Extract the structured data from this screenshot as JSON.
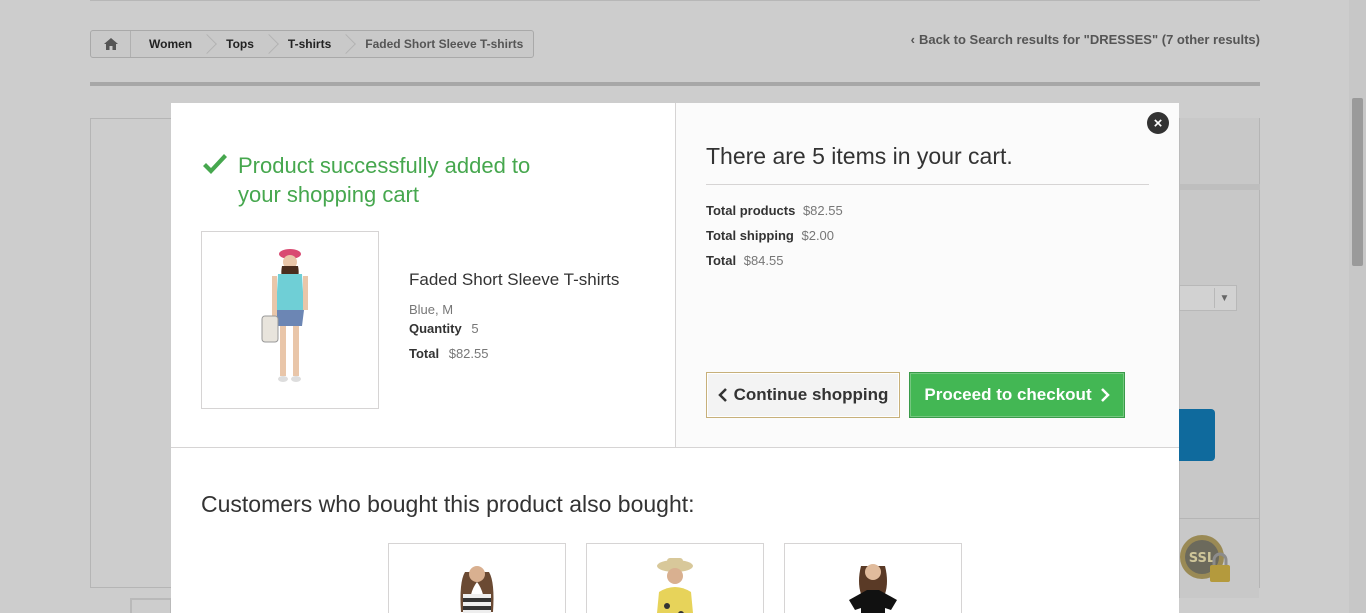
{
  "breadcrumb": {
    "home_icon": "home-icon",
    "items": [
      "Women",
      "Tops",
      "T-shirts"
    ],
    "current": "Faded Short Sleeve T-shirts"
  },
  "back_link": "Back to Search results for \"DRESSES\" (7 other results)",
  "modal": {
    "success_message": "Product successfully added to your shopping cart",
    "product": {
      "name": "Faded Short Sleeve T-shirts",
      "attributes": "Blue, M",
      "quantity_label": "Quantity",
      "quantity": "5",
      "total_label": "Total",
      "total": "$82.55"
    },
    "cart": {
      "title": "There are 5 items in your cart.",
      "total_products_label": "Total products",
      "total_products": "$82.55",
      "total_shipping_label": "Total shipping",
      "total_shipping": "$2.00",
      "total_label": "Total",
      "total": "$84.55"
    },
    "continue_label": "Continue shopping",
    "checkout_label": "Proceed to checkout",
    "also_bought_title": "Customers who bought this product also bought:"
  },
  "colors": {
    "success_green": "#46a74e",
    "checkout_green": "#43b754",
    "overlay_gray": "#cdcdcd"
  }
}
